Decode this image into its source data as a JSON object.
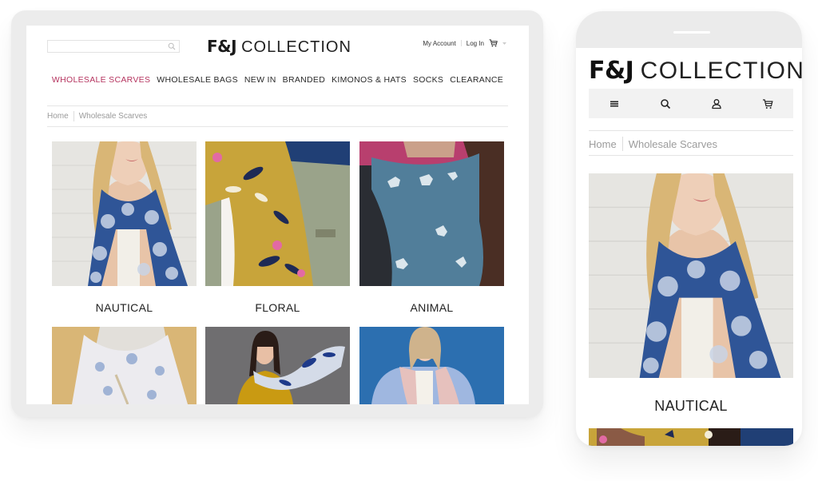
{
  "brand": {
    "name_bold": "F&J",
    "name_light": "COLLECTION",
    "accent_color": "#b5345f"
  },
  "tablet": {
    "search": {
      "placeholder": "",
      "icon": "search-icon"
    },
    "account": {
      "my_account": "My Account",
      "log_in": "Log In",
      "cart_icon": "cart-icon"
    },
    "nav": [
      {
        "label": "WHOLESALE SCARVES",
        "active": true
      },
      {
        "label": "WHOLESALE BAGS",
        "active": false
      },
      {
        "label": "NEW IN",
        "active": false
      },
      {
        "label": "BRANDED",
        "active": false
      },
      {
        "label": "KIMONOS & HATS",
        "active": false
      },
      {
        "label": "SOCKS",
        "active": false
      },
      {
        "label": "CLEARANCE",
        "active": false
      }
    ],
    "breadcrumb": [
      "Home",
      "Wholesale Scarves"
    ],
    "categories": [
      {
        "label": "NAUTICAL",
        "image": "woman in blue scarf with white shell print"
      },
      {
        "label": "FLORAL",
        "image": "mustard yellow floral scarf with olive jacket"
      },
      {
        "label": "ANIMAL",
        "image": "teal scarf with white deer print"
      },
      {
        "label": "",
        "image": "white scarf with blue floral print"
      },
      {
        "label": "",
        "image": "woman in yellow top waving blue floral scarf"
      },
      {
        "label": "",
        "image": "woman in pale blue coat and pink scarf"
      }
    ]
  },
  "phone": {
    "icons": [
      "menu-icon",
      "search-icon",
      "account-icon",
      "cart-icon"
    ],
    "breadcrumb": [
      "Home",
      "Wholesale Scarves"
    ],
    "categories": [
      {
        "label": "NAUTICAL",
        "image": "woman in blue scarf with white shell print"
      },
      {
        "label": "",
        "image": "mustard yellow floral scarf"
      }
    ]
  }
}
